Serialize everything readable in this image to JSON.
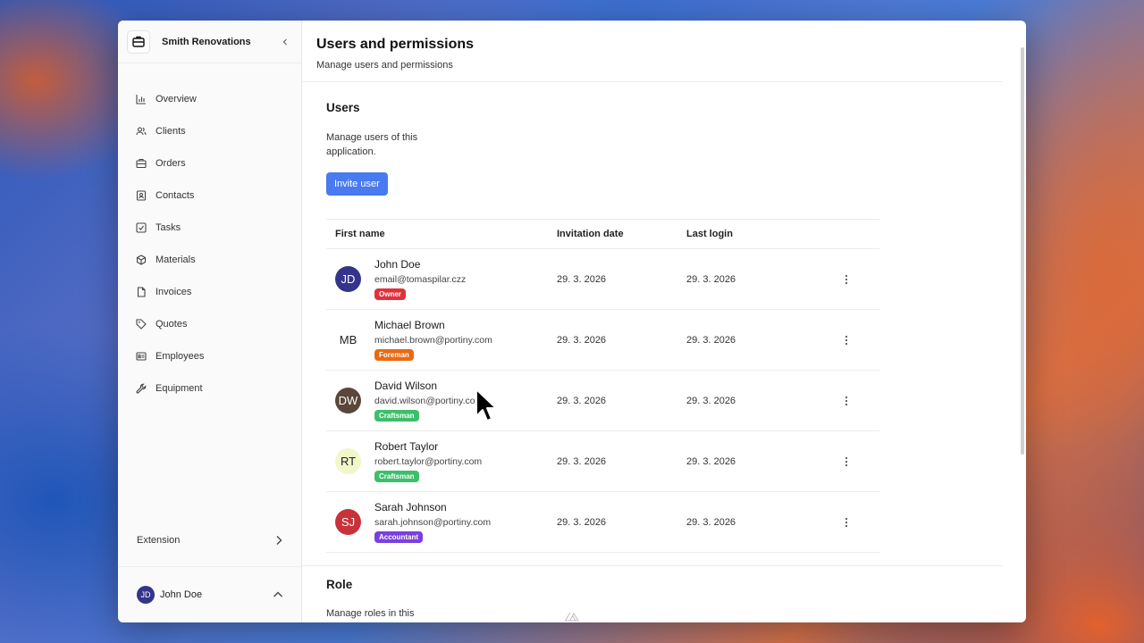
{
  "app": {
    "brand": "Smith Renovations"
  },
  "sidebar": {
    "items": [
      {
        "label": "Overview",
        "icon": "bar-chart-icon"
      },
      {
        "label": "Clients",
        "icon": "users-icon"
      },
      {
        "label": "Orders",
        "icon": "briefcase-icon"
      },
      {
        "label": "Contacts",
        "icon": "contact-card-icon"
      },
      {
        "label": "Tasks",
        "icon": "check-square-icon"
      },
      {
        "label": "Materials",
        "icon": "box-icon"
      },
      {
        "label": "Invoices",
        "icon": "file-icon"
      },
      {
        "label": "Quotes",
        "icon": "tag-icon"
      },
      {
        "label": "Employees",
        "icon": "id-card-icon"
      },
      {
        "label": "Equipment",
        "icon": "wrench-icon"
      }
    ],
    "extension_label": "Extension",
    "user": {
      "name": "John Doe",
      "initials": "JD"
    }
  },
  "page": {
    "title": "Users and permissions",
    "subtitle": "Manage users and permissions"
  },
  "users_section": {
    "title": "Users",
    "description": "Manage users of this application.",
    "invite_label": "Invite user",
    "columns": [
      "First name",
      "Invitation date",
      "Last login"
    ],
    "rows": [
      {
        "initials": "JD",
        "name": "John Doe",
        "email": "email@tomaspilar.czz",
        "role": "Owner",
        "role_color": "#e0323c",
        "avatar_bg": "#34348a",
        "avatar_fg": "#ffffff",
        "invited": "29. 3. 2026",
        "last_login": "29. 3. 2026"
      },
      {
        "initials": "MB",
        "name": "Michael Brown",
        "email": "michael.brown@portiny.com",
        "role": "Foreman",
        "role_color": "#ea6a12",
        "avatar_bg": "#ffffff",
        "avatar_fg": "#222222",
        "invited": "29. 3. 2026",
        "last_login": "29. 3. 2026"
      },
      {
        "initials": "DW",
        "name": "David Wilson",
        "email": "david.wilson@portiny.com",
        "role": "Craftsman",
        "role_color": "#3cbf6a",
        "avatar_bg": "#5a463a",
        "avatar_fg": "#ffffff",
        "invited": "29. 3. 2026",
        "last_login": "29. 3. 2026"
      },
      {
        "initials": "RT",
        "name": "Robert Taylor",
        "email": "robert.taylor@portiny.com",
        "role": "Craftsman",
        "role_color": "#3cbf6a",
        "avatar_bg": "#f1f7c8",
        "avatar_fg": "#222222",
        "invited": "29. 3. 2026",
        "last_login": "29. 3. 2026"
      },
      {
        "initials": "SJ",
        "name": "Sarah Johnson",
        "email": "sarah.johnson@portiny.com",
        "role": "Accountant",
        "role_color": "#7a3fe0",
        "avatar_bg": "#c8323a",
        "avatar_fg": "#ffffff",
        "invited": "29. 3. 2026",
        "last_login": "29. 3. 2026"
      }
    ]
  },
  "role_section": {
    "title": "Role",
    "description": "Manage roles in this"
  },
  "colors": {
    "accent": "#4a7af0"
  }
}
